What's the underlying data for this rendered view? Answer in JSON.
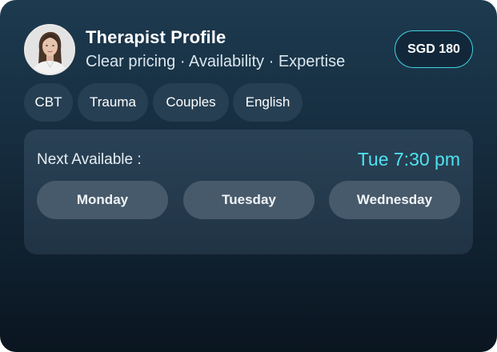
{
  "profile": {
    "title": "Therapist Profile",
    "subtitle": "Clear pricing · Availability · Expertise",
    "price": "SGD 180"
  },
  "tags": [
    "CBT",
    "Trauma",
    "Couples",
    "English"
  ],
  "availability": {
    "label": "Next Available :",
    "time": "Tue 7:30 pm",
    "days": [
      "Monday",
      "Tuesday",
      "Wednesday"
    ]
  },
  "colors": {
    "accent": "#4fe3f0",
    "badge_border": "#3fd3e3",
    "card_top": "#1d3a4f",
    "card_bottom": "#0a1520"
  }
}
